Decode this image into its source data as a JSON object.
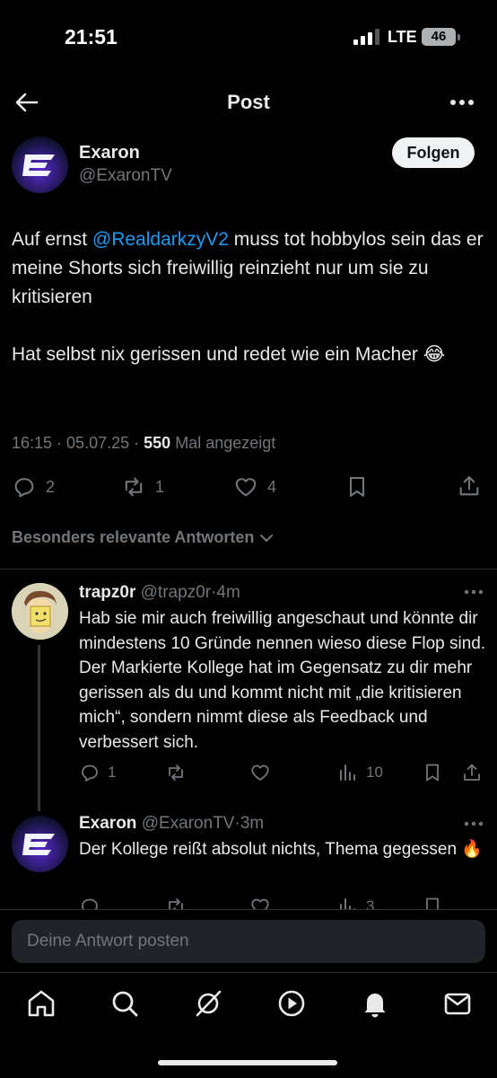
{
  "status_bar": {
    "time": "21:51",
    "network": "LTE",
    "battery": "46"
  },
  "nav": {
    "title": "Post",
    "back_icon": "arrow-left-icon",
    "more_icon": "more-horizontal-icon"
  },
  "post": {
    "author_name": "Exaron",
    "author_handle": "@ExaronTV",
    "follow_label": "Folgen",
    "text_prefix": "Auf ernst ",
    "mention": "@RealdarkzyV2",
    "text_suffix": " muss tot hobbylos sein das er meine Shorts sich freiwillig reinzieht nur um sie zu kritisieren",
    "text_second": "Hat selbst nix gerissen und redet wie ein Macher 😂",
    "time": "16:15",
    "date": "05.07.25",
    "views_count": "550",
    "views_label": "Mal angezeigt",
    "replies": "2",
    "reposts": "1",
    "likes": "4"
  },
  "relevant_replies_label": "Besonders relevante Antworten",
  "replies": [
    {
      "name": "trapz0r",
      "handle": "@trapz0r",
      "age": "4m",
      "text": "Hab sie mir auch freiwillig angeschaut und könnte dir mindestens 10 Gründe nennen wieso diese Flop sind. Der Markierte Kollege hat im Gegensatz zu dir mehr gerissen als du und kommt nicht mit „die kritisieren mich“, sondern nimmt diese als Feedback und verbessert sich.",
      "replies": "1",
      "views": "10"
    },
    {
      "name": "Exaron",
      "handle": "@ExaronTV",
      "age": "3m",
      "text": "Der Kollege reißt absolut nichts, Thema gegessen 🔥",
      "views": "3"
    }
  ],
  "composer": {
    "placeholder": "Deine Antwort posten"
  },
  "tabbar": [
    "home-icon",
    "search-icon",
    "grok-icon",
    "video-icon",
    "notifications-icon",
    "messages-icon"
  ],
  "colors": {
    "background": "#000000",
    "text": "#e7e9ea",
    "muted": "#71767b",
    "link": "#1d9bf0",
    "follow_button": "#eff3f4"
  }
}
